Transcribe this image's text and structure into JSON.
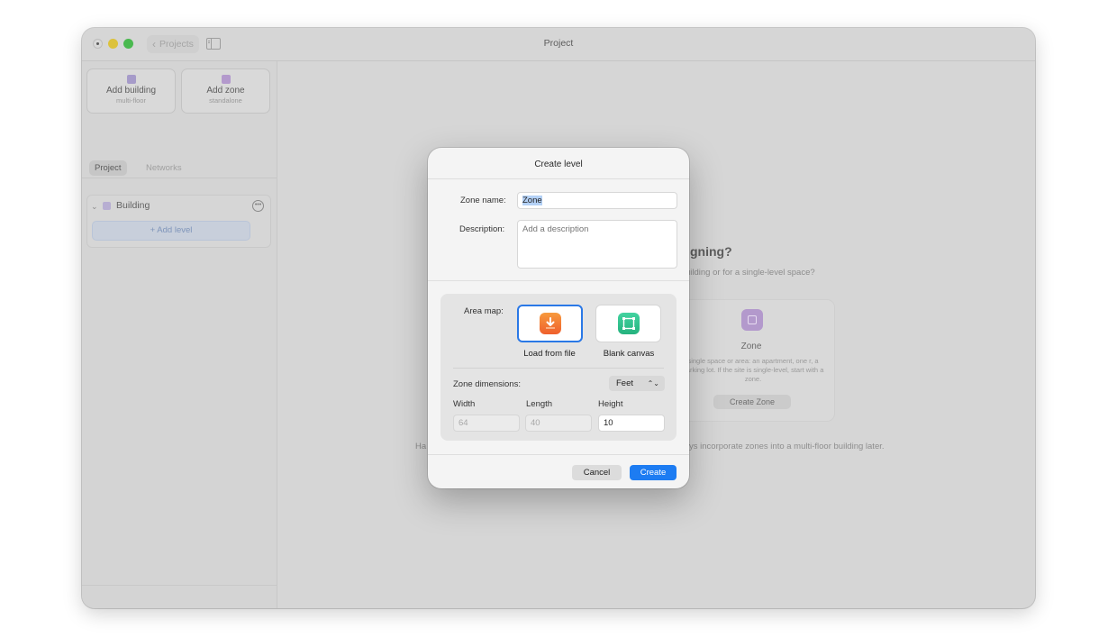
{
  "window": {
    "title": "Project",
    "back_label": "Projects"
  },
  "sidebar": {
    "add_building": {
      "label": "Add building",
      "sub": "multi-floor"
    },
    "add_zone": {
      "label": "Add zone",
      "sub": "standalone"
    },
    "tabs": [
      "Project",
      "Networks"
    ],
    "active_tab": "Project",
    "tree": {
      "building_name": "Building",
      "add_level_label": "+ Add level"
    }
  },
  "background": {
    "heading": "gning?",
    "subheading": "uilding or for a single-level space?",
    "zone_card": {
      "title": "Zone",
      "description": "single space or area: an apartment, one r, a parking lot. If the site is single-level, start with a zone.",
      "button": "Create Zone"
    },
    "footer_left": "Ha",
    "footer_right": "ys incorporate zones into a multi-floor building later."
  },
  "dialog": {
    "title": "Create level",
    "zone_name_label": "Zone name:",
    "zone_name_value": "Zone",
    "description_label": "Description:",
    "description_placeholder": "Add a description",
    "area_map_label": "Area map:",
    "area_map_options": [
      "Load from file",
      "Blank canvas"
    ],
    "area_map_selected": "Load from file",
    "zone_dimensions_label": "Zone dimensions:",
    "unit": "Feet",
    "width_label": "Width",
    "width_value": "64",
    "length_label": "Length",
    "length_value": "40",
    "height_label": "Height",
    "height_value": "10",
    "cancel_label": "Cancel",
    "create_label": "Create"
  },
  "colors": {
    "accent": "#1d7cf2",
    "load_icon": "#f07a30",
    "blank_icon": "#2fc18c",
    "building_icon": "#a69bc9",
    "zone_icon": "#b399cc"
  },
  "icons": {
    "load_from_file": "download-icon",
    "blank_canvas": "selection-square-icon",
    "building": "building-icon",
    "zone": "zone-icon"
  }
}
